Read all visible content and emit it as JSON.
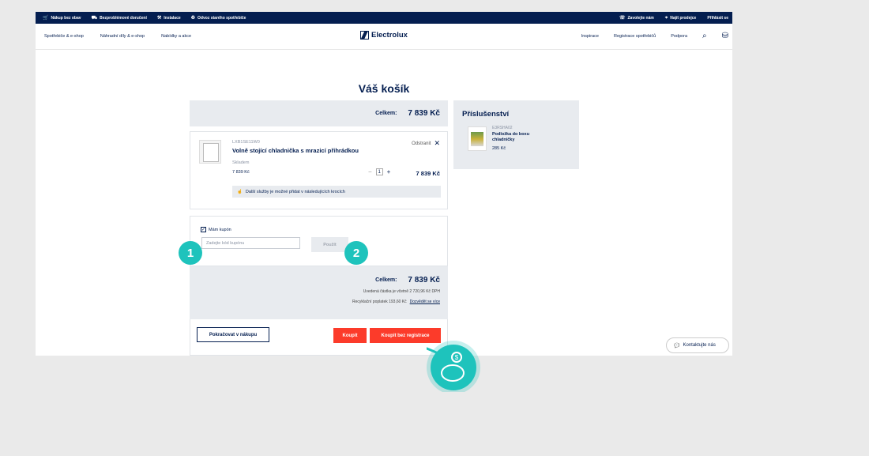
{
  "topbar": {
    "left": [
      {
        "icon": "cart-icon",
        "label": "Nákup bez obav"
      },
      {
        "icon": "truck-icon",
        "label": "Bezproblémové doručení"
      },
      {
        "icon": "wrench-icon",
        "label": "Instalace"
      },
      {
        "icon": "recycle-icon",
        "label": "Odvoz starého spotřebiče"
      }
    ],
    "right": [
      {
        "icon": "phone-icon",
        "label": "Zavolejte nám"
      },
      {
        "icon": "pin-icon",
        "label": "Najít prodejce"
      },
      {
        "icon": "",
        "label": "Přihlásit se"
      }
    ]
  },
  "nav": {
    "left": [
      "Spotřebiče & e-shop",
      "Náhradní díly & e-shop",
      "Nabídky a akce"
    ],
    "logo": "Electrolux",
    "right": [
      "Inspirace",
      "Registrace spotřebičů",
      "Podpora"
    ]
  },
  "page_title": "Váš košík",
  "summary": {
    "label": "Celkem:",
    "value": "7 839 Kč"
  },
  "item": {
    "sku": "LXB1SE11W0",
    "name": "Volně stojící chladnička s mrazicí přihrádkou",
    "remove": "Odstranit",
    "stock": "Skladem",
    "unit_price": "7 839 Kč",
    "qty": "1",
    "line_price": "7 839 Kč",
    "services": "Další služby je možné přidat v následujících krocích"
  },
  "coupon": {
    "checkbox": "Mám kupón",
    "placeholder": "Zadejte kód kupónu",
    "apply": "Použít"
  },
  "total": {
    "label": "Celkem:",
    "value": "7 839 Kč",
    "vat": "Uvedená částka je včetně 2 720,96 Kč DPH",
    "recycle": "Recyklační poplatek 193,60 Kč",
    "recycle_link": "Dozvědět se více"
  },
  "actions": {
    "continue": "Pokračovat v nákupu",
    "buy": "Koupit",
    "buy_guest": "Koupit bez registrace"
  },
  "accessories": {
    "title": "Příslušenství",
    "sku": "E3RSHA02",
    "name": "Podložka do boxu chladničky",
    "price": "285 Kč"
  },
  "contact": "Kontaktujte nás",
  "badges": {
    "one": "1",
    "two": "2"
  },
  "accent_colors": {
    "navy": "#041e50",
    "red": "#fc3b2a",
    "teal": "#1ec3bc"
  }
}
